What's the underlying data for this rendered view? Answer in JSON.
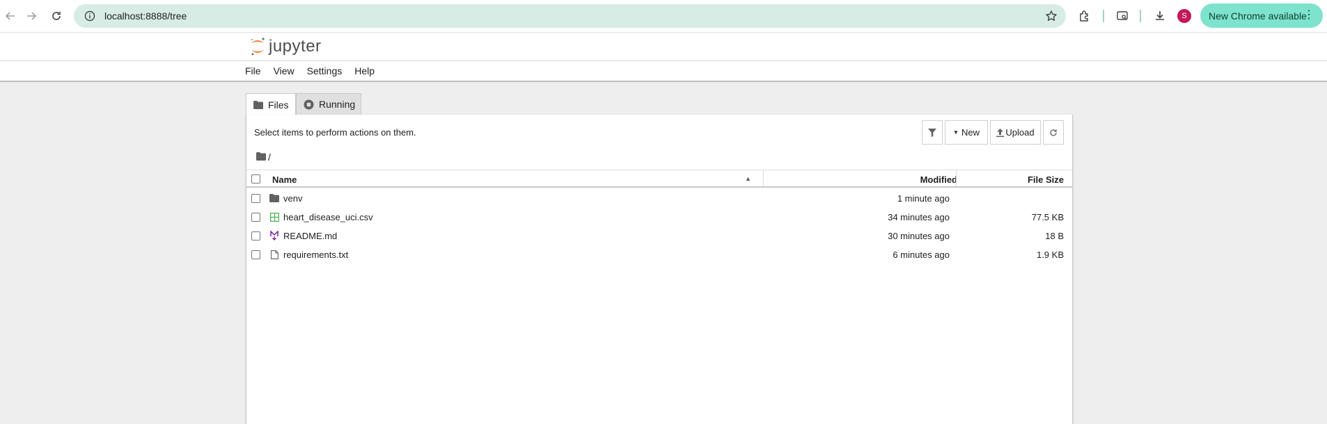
{
  "browser": {
    "url": "localhost:8888/tree",
    "avatar_letter": "S",
    "update_label": "New Chrome available"
  },
  "jupyter": {
    "logo_text": "jupyter",
    "menu": [
      "File",
      "View",
      "Settings",
      "Help"
    ],
    "tabs": [
      {
        "label": "Files",
        "icon": "folder-icon"
      },
      {
        "label": "Running",
        "icon": "stop-circle-icon"
      }
    ],
    "toolbar": {
      "hint": "Select items to perform actions on them.",
      "new_label": "New",
      "upload_label": "Upload"
    },
    "breadcrumb": "/",
    "columns": {
      "name": "Name",
      "modified": "Modified",
      "size": "File Size"
    },
    "files": [
      {
        "name": "venv",
        "type": "folder",
        "modified": "1 minute ago",
        "size": ""
      },
      {
        "name": "heart_disease_uci.csv",
        "type": "spreadsheet",
        "modified": "34 minutes ago",
        "size": "77.5 KB"
      },
      {
        "name": "README.md",
        "type": "markdown",
        "modified": "30 minutes ago",
        "size": "18 B"
      },
      {
        "name": "requirements.txt",
        "type": "text",
        "modified": "6 minutes ago",
        "size": "1.9 KB"
      }
    ]
  },
  "colors": {
    "omnibox": "#d7ece4",
    "update_button": "#7ee3cc",
    "jupyter_orange": "#f37726",
    "csv_green": "#4caf50",
    "md_purple": "#7b1fa2",
    "avatar": "#c2185b"
  }
}
